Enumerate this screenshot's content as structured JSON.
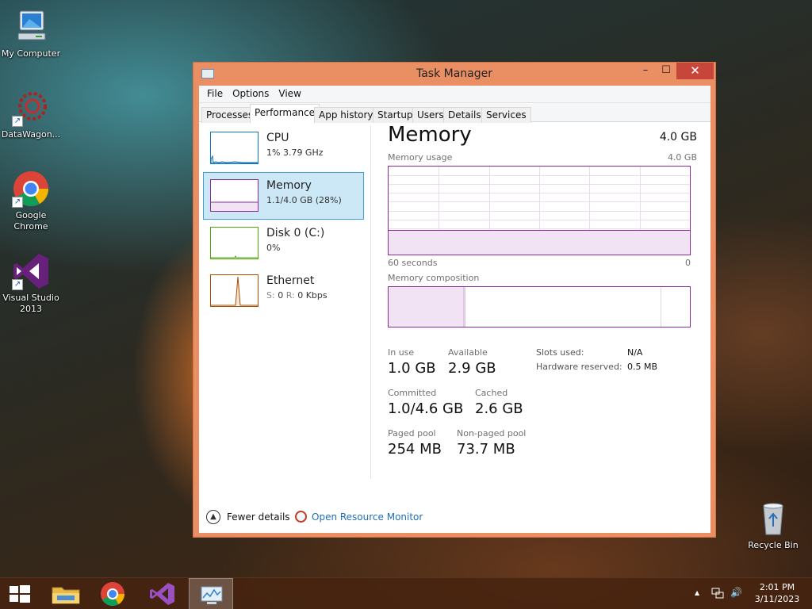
{
  "desktop": {
    "icons": [
      {
        "label": "My Computer"
      },
      {
        "label": "DataWagon..."
      },
      {
        "label": "Google Chrome"
      },
      {
        "label": "Visual Studio 2013"
      },
      {
        "label": "Recycle Bin"
      }
    ]
  },
  "window": {
    "title": "Task Manager",
    "controls": {
      "minimize": "–",
      "maximize": "☐",
      "close": "✕"
    },
    "menu": [
      "File",
      "Options",
      "View"
    ],
    "tabs": [
      "Processes",
      "Performance",
      "App history",
      "Startup",
      "Users",
      "Details",
      "Services"
    ],
    "active_tab": "Performance"
  },
  "sidebar": [
    {
      "name": "CPU",
      "detail": "1% 3.79 GHz",
      "color": "#1177bb"
    },
    {
      "name": "Memory",
      "detail": "1.1/4.0 GB (28%)",
      "color": "#8b2a9a"
    },
    {
      "name": "Disk 0 (C:)",
      "detail": "0%",
      "color": "#4da60c"
    },
    {
      "name": "Ethernet",
      "detail_s": "S:",
      "detail_s_val": "0",
      "detail_r": "R:",
      "detail_r_val": "0 Kbps",
      "color": "#a74f01"
    }
  ],
  "memory": {
    "title": "Memory",
    "total": "4.0 GB",
    "usage_label": "Memory usage",
    "usage_max": "4.0 GB",
    "axis_left": "60 seconds",
    "axis_right": "0",
    "composition_label": "Memory composition",
    "usage_fraction": 0.28,
    "composition": {
      "in_use": 1.0,
      "modified": 0.02,
      "standby": 2.6,
      "free": 0.38,
      "total": 4.0
    },
    "stats": {
      "in_use_label": "In use",
      "in_use": "1.0 GB",
      "available_label": "Available",
      "available": "2.9 GB",
      "committed_label": "Committed",
      "committed": "1.0/4.6 GB",
      "cached_label": "Cached",
      "cached": "2.6 GB",
      "paged_label": "Paged pool",
      "paged": "254 MB",
      "nonpaged_label": "Non-paged pool",
      "nonpaged": "73.7 MB"
    },
    "hardware": {
      "slots_label": "Slots used:",
      "slots": "N/A",
      "reserved_label": "Hardware reserved:",
      "reserved": "0.5 MB"
    }
  },
  "footer": {
    "fewer_details": "Fewer details",
    "resource_monitor": "Open Resource Monitor"
  },
  "taskbar": {
    "time": "2:01 PM",
    "date": "3/11/2023",
    "tray_expand": "▲",
    "volume": "🔊"
  },
  "colors": {
    "accent_window": "#ea8e63",
    "memory": "#8b2a9a",
    "cpu": "#1177bb",
    "disk": "#4da60c",
    "ethernet": "#a74f01",
    "link": "#1e6fb5"
  }
}
